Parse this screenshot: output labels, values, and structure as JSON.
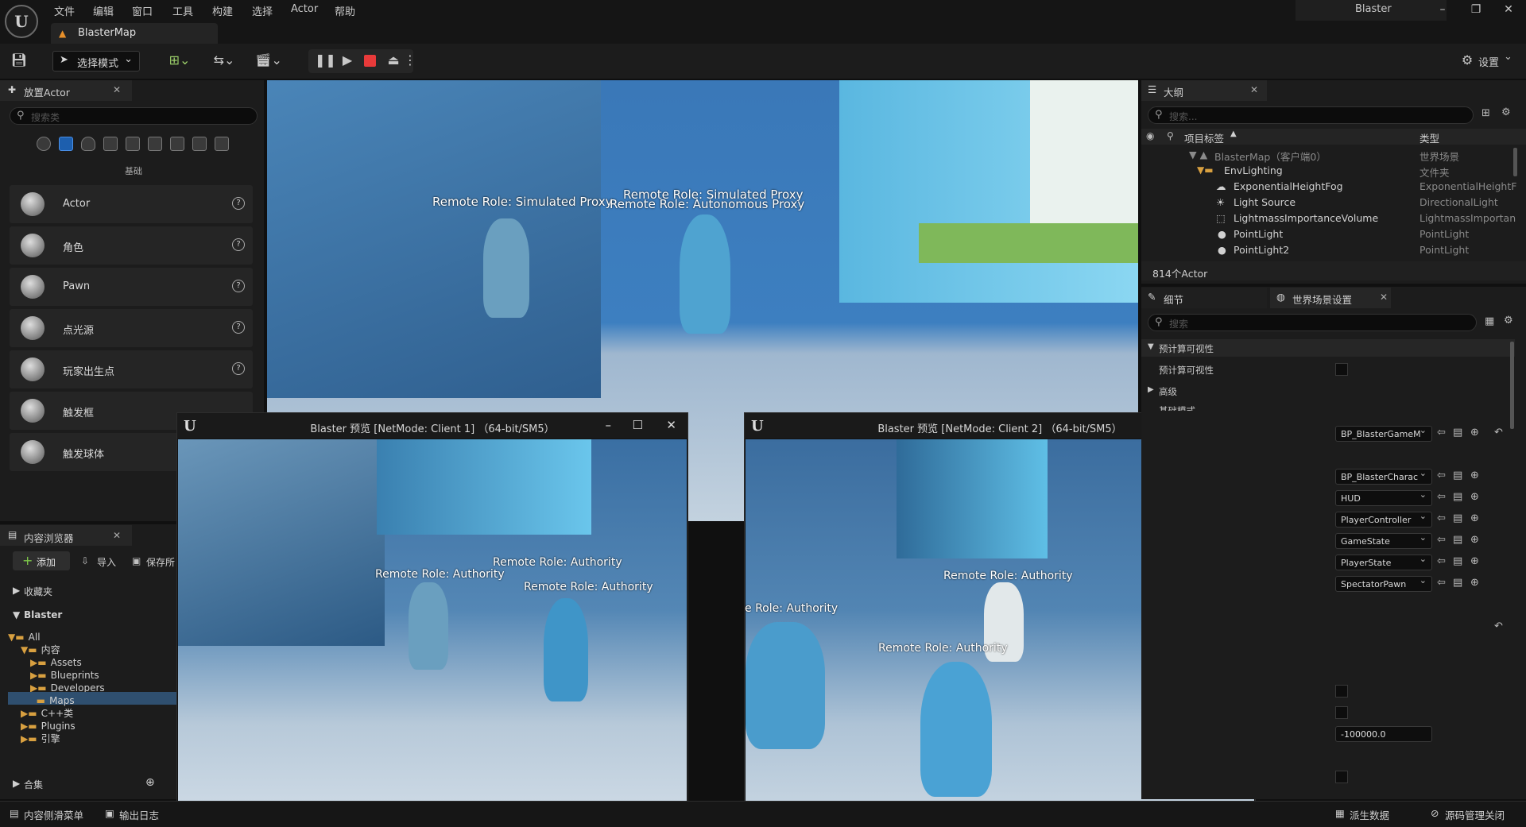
{
  "app": {
    "menu": [
      "文件",
      "编辑",
      "窗口",
      "工具",
      "构建",
      "选择",
      "Actor",
      "帮助"
    ],
    "project_name": "Blaster",
    "map_tab": "BlasterMap"
  },
  "toolbar": {
    "select_mode": "选择模式",
    "settings": "设置"
  },
  "place_actors": {
    "tab": "放置Actor",
    "search_placeholder": "搜索类",
    "category_label": "基础",
    "items": [
      "Actor",
      "角色",
      "Pawn",
      "点光源",
      "玩家出生点",
      "触发框",
      "触发球体"
    ],
    "help": "?"
  },
  "content_browser": {
    "tab": "内容浏览器",
    "add": "添加",
    "import": "导入",
    "save": "保存所",
    "favorites": "收藏夹",
    "project": "Blaster",
    "tree": [
      "All",
      "内容",
      "Assets",
      "Blueprints",
      "Developers",
      "Maps",
      "C++类",
      "Plugins",
      "引擎"
    ],
    "collections": "合集"
  },
  "viewport": {
    "labels": [
      "Remote Role: Simulated Proxy",
      "Remote Role: Simulated Proxy",
      "Remote Role: Autonomous Proxy"
    ]
  },
  "client1": {
    "title": "Blaster 预览 [NetMode: Client 1]  （64-bit/SM5）",
    "labels": [
      "Remote Role: Authority",
      "Remote Role: Authority",
      "Remote Role: Authority"
    ]
  },
  "client2": {
    "title": "Blaster 预览 [NetMode: Client 2]  （64-bit/SM5）",
    "labels": [
      "Remote Role: Authority",
      "e Role: Authority",
      "Remote Role: Authority"
    ]
  },
  "outliner": {
    "tab": "大纲",
    "search_placeholder": "搜索...",
    "col_label": "项目标签",
    "col_type": "类型",
    "rows": [
      {
        "label": "BlasterMap（客户端0）",
        "type": "世界场景"
      },
      {
        "label": "EnvLighting",
        "type": "文件夹"
      },
      {
        "label": "ExponentialHeightFog",
        "type": "ExponentialHeightF"
      },
      {
        "label": "Light Source",
        "type": "DirectionalLight"
      },
      {
        "label": "LightmassImportanceVolume",
        "type": "LightmassImportan"
      },
      {
        "label": "PointLight",
        "type": "PointLight"
      },
      {
        "label": "PointLight2",
        "type": "PointLight"
      }
    ],
    "count": "814个Actor"
  },
  "details": {
    "tab": "细节",
    "tab2": "世界场景设置",
    "search_placeholder": "搜索",
    "section": "预计算可视性",
    "prop": "预计算可视性",
    "advanced": "高级",
    "partial": "基础模式",
    "dropdowns": [
      "BP_BlasterGameM",
      "BP_BlasterCharac",
      "HUD",
      "PlayerController",
      "GameState",
      "PlayerState",
      "SpectatorPawn"
    ],
    "number_value": "-100000.0"
  },
  "statusbar": {
    "content_drawer": "内容侧滑菜单",
    "output_log": "输出日志",
    "derived_data": "派生数据",
    "source_control": "源码管理关闭"
  }
}
